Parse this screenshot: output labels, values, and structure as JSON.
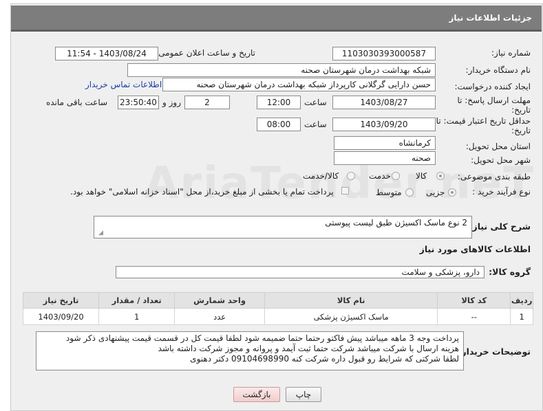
{
  "header": {
    "title": "جزئیات اطلاعات نیاز"
  },
  "form": {
    "need_number_label": "شماره نیاز:",
    "need_number": "1103030393000587",
    "announce_label": "تاریخ و ساعت اعلان عمومی:",
    "announce_value": "1403/08/24 - 11:54",
    "buyer_org_label": "نام دستگاه خریدار:",
    "buyer_org": "شبکه بهداشت درمان شهرستان صحنه",
    "requester_label": "ایجاد کننده درخواست:",
    "requester": "حسن دارایی گرگلانی کارپرداز شبکه بهداشت درمان شهرستان صحنه",
    "contact_link": "اطلاعات تماس خریدار",
    "reply_deadline_label_1": "مهلت ارسال پاسخ: تا",
    "reply_deadline_label_2": "تاریخ:",
    "reply_date": "1403/08/27",
    "time_label": "ساعت",
    "reply_time": "12:00",
    "days_value": "2",
    "days_label": "روز و",
    "remaining_time": "23:50:40",
    "remaining_label": "ساعت باقی مانده",
    "price_validity_label_1": "حداقل تاریخ اعتبار قیمت: تا",
    "price_validity_label_2": "تاریخ:",
    "validity_date": "1403/09/20",
    "validity_time": "08:00",
    "province_label": "استان محل تحویل:",
    "province": "کرمانشاه",
    "city_label": "شهر محل تحویل:",
    "city": "صحنه",
    "category_label": "طبقه بندی موضوعی:",
    "category_options": [
      "کالا",
      "خدمت",
      "کالا/خدمت"
    ],
    "purchase_type_label": "نوع فرآیند خرید :",
    "purchase_options": [
      "جزیی",
      "متوسط"
    ],
    "payment_note": "پرداخت تمام یا بخشی از مبلغ خرید،از محل \"اسناد خزانه اسلامی\" خواهد بود.",
    "description_label": "شرح کلی نیاز:",
    "description": "2 نوع ماسک اکسیژن طبق لیست پیوستی"
  },
  "goods": {
    "section_title": "اطلاعات کالاهای مورد نیاز",
    "group_label": "گروه کالا:",
    "group_value": "دارو، پزشکی و سلامت",
    "columns": [
      "ردیف",
      "کد کالا",
      "نام کالا",
      "واحد شمارش",
      "تعداد / مقدار",
      "تاریخ نیاز"
    ],
    "rows": [
      {
        "index": "1",
        "code": "--",
        "name": "ماسک اکسیژن پزشکی",
        "unit": "عدد",
        "qty": "1",
        "date": "1403/09/20"
      }
    ]
  },
  "buyer_notes": {
    "label": "توضیحات خریدار:",
    "line1": "پرداخت وجه 3 ماهه میباشد پیش فاکتو رحتما حتما ضمیمه شود لطفا قیمت کل در قسمت قیمت پیشنهادی ذکر شود",
    "line2": "هزینه ارسال با شرکت میباشد  شرکت حتما ثبت آیمد و پروانه و مجوز شرکت داشته باشد",
    "line3": "لطفا شرکتی که شرایط رو قبول داره شرکت کنه   09104698990  دکتر دهنوی"
  },
  "buttons": {
    "print": "چاپ",
    "back": "بازگشت"
  },
  "watermark": "AriaTender.neT"
}
